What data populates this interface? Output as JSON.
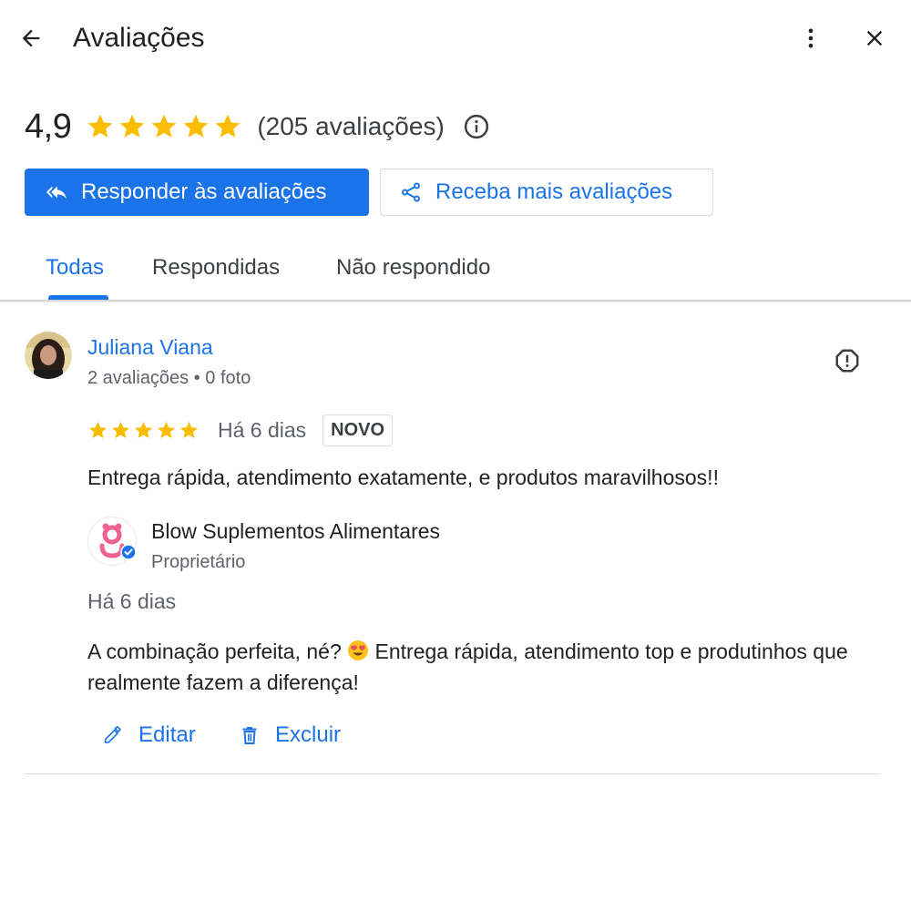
{
  "header": {
    "title": "Avaliações"
  },
  "summary": {
    "average": "4,9",
    "stars": 5,
    "count_label": "(205 avaliações)"
  },
  "actions": {
    "reply_label": "Responder às avaliações",
    "get_more_label": "Receba mais avaliações"
  },
  "tabs": [
    {
      "label": "Todas",
      "active": true
    },
    {
      "label": "Respondidas",
      "active": false
    },
    {
      "label": "Não respondido",
      "active": false
    }
  ],
  "review": {
    "author": "Juliana Viana",
    "meta": "2 avaliações • 0 foto",
    "rating": 5,
    "date": "Há 6 dias",
    "badge": "NOVO",
    "text": "Entrega rápida, atendimento exatamente, e produtos maravilhosos!!",
    "reply": {
      "owner_name": "Blow Suplementos Alimentares",
      "owner_role": "Proprietário",
      "date": "Há 6 dias",
      "text_before_emoji": "A combinação perfeita, né? ",
      "emoji": "heart-eyes-emoji",
      "text_after_emoji": " Entrega rápida, atendimento top e produtinhos que realmente fazem a diferença!",
      "edit_label": "Editar",
      "delete_label": "Excluir"
    }
  },
  "colors": {
    "accent": "#1a73e8",
    "star": "#fbbc04",
    "text": "#202124",
    "secondary_text": "#5f6368",
    "brand_pink": "#f06292"
  }
}
